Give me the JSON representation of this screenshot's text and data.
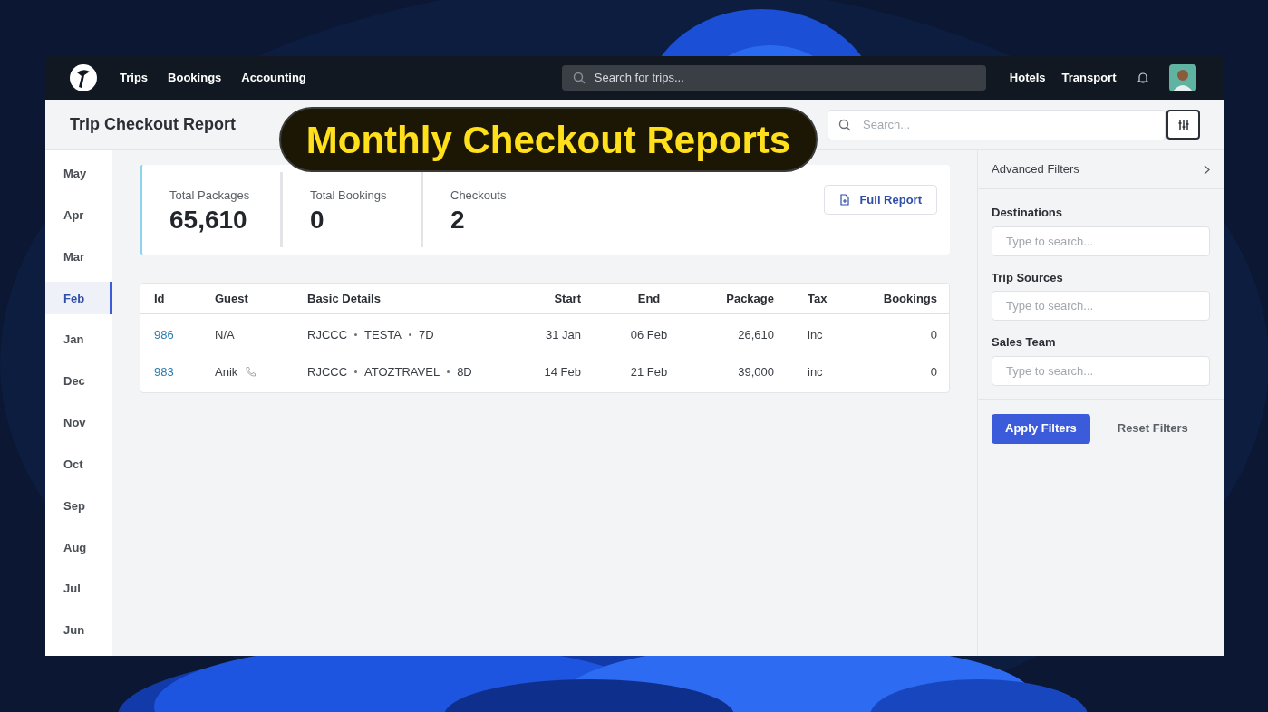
{
  "nav": {
    "links": [
      "Trips",
      "Bookings",
      "Accounting"
    ],
    "search_placeholder": "Search for trips...",
    "right_links": [
      "Hotels",
      "Transport"
    ]
  },
  "page_title": "Trip Checkout Report",
  "banner": "Monthly Checkout Reports",
  "search": {
    "placeholder": "Search..."
  },
  "months": [
    {
      "label": "May",
      "selected": false
    },
    {
      "label": "Apr",
      "selected": false
    },
    {
      "label": "Mar",
      "selected": false
    },
    {
      "label": "Feb",
      "selected": true
    },
    {
      "label": "Jan",
      "selected": false
    },
    {
      "label": "Dec",
      "selected": false
    },
    {
      "label": "Nov",
      "selected": false
    },
    {
      "label": "Oct",
      "selected": false
    },
    {
      "label": "Sep",
      "selected": false
    },
    {
      "label": "Aug",
      "selected": false
    },
    {
      "label": "Jul",
      "selected": false
    },
    {
      "label": "Jun",
      "selected": false
    }
  ],
  "stats": [
    {
      "label": "Total Packages",
      "value": "65,610"
    },
    {
      "label": "Total Bookings",
      "value": "0"
    },
    {
      "label": "Checkouts",
      "value": "2"
    }
  ],
  "full_report_button": "Full Report",
  "table": {
    "columns": [
      "Id",
      "Guest",
      "Basic Details",
      "Start",
      "End",
      "Package",
      "Tax",
      "Bookings"
    ],
    "rows": [
      {
        "id": "986",
        "guest": "N/A",
        "has_phone": false,
        "details": [
          "RJCCC",
          "TESTA",
          "7D"
        ],
        "start": "31 Jan",
        "end": "06 Feb",
        "package": "26,610",
        "tax": "inc",
        "bookings": "0"
      },
      {
        "id": "983",
        "guest": "Anik",
        "has_phone": true,
        "details": [
          "RJCCC",
          "ATOZTRAVEL",
          "8D"
        ],
        "start": "14 Feb",
        "end": "21 Feb",
        "package": "39,000",
        "tax": "inc",
        "bookings": "0"
      }
    ]
  },
  "filters": {
    "title": "Advanced Filters",
    "fields": [
      {
        "label": "Destinations",
        "placeholder": "Type to search..."
      },
      {
        "label": "Trip Sources",
        "placeholder": "Type to search..."
      },
      {
        "label": "Sales Team",
        "placeholder": "Type to search..."
      }
    ],
    "apply_button": "Apply Filters",
    "reset_button": "Reset Filters"
  }
}
